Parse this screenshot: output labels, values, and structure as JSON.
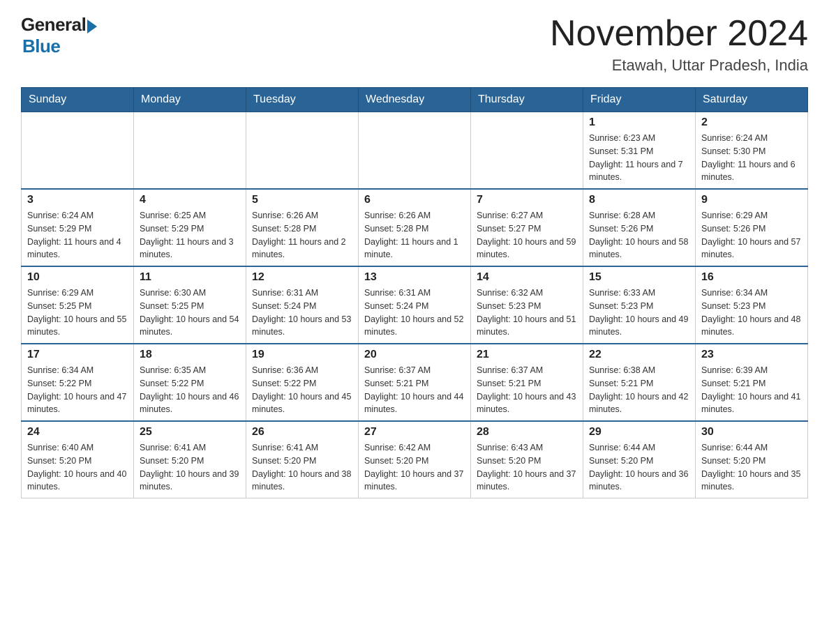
{
  "logo": {
    "general": "General",
    "blue": "Blue"
  },
  "title": "November 2024",
  "subtitle": "Etawah, Uttar Pradesh, India",
  "days_of_week": [
    "Sunday",
    "Monday",
    "Tuesday",
    "Wednesday",
    "Thursday",
    "Friday",
    "Saturday"
  ],
  "weeks": [
    [
      {
        "day": "",
        "info": ""
      },
      {
        "day": "",
        "info": ""
      },
      {
        "day": "",
        "info": ""
      },
      {
        "day": "",
        "info": ""
      },
      {
        "day": "",
        "info": ""
      },
      {
        "day": "1",
        "info": "Sunrise: 6:23 AM\nSunset: 5:31 PM\nDaylight: 11 hours and 7 minutes."
      },
      {
        "day": "2",
        "info": "Sunrise: 6:24 AM\nSunset: 5:30 PM\nDaylight: 11 hours and 6 minutes."
      }
    ],
    [
      {
        "day": "3",
        "info": "Sunrise: 6:24 AM\nSunset: 5:29 PM\nDaylight: 11 hours and 4 minutes."
      },
      {
        "day": "4",
        "info": "Sunrise: 6:25 AM\nSunset: 5:29 PM\nDaylight: 11 hours and 3 minutes."
      },
      {
        "day": "5",
        "info": "Sunrise: 6:26 AM\nSunset: 5:28 PM\nDaylight: 11 hours and 2 minutes."
      },
      {
        "day": "6",
        "info": "Sunrise: 6:26 AM\nSunset: 5:28 PM\nDaylight: 11 hours and 1 minute."
      },
      {
        "day": "7",
        "info": "Sunrise: 6:27 AM\nSunset: 5:27 PM\nDaylight: 10 hours and 59 minutes."
      },
      {
        "day": "8",
        "info": "Sunrise: 6:28 AM\nSunset: 5:26 PM\nDaylight: 10 hours and 58 minutes."
      },
      {
        "day": "9",
        "info": "Sunrise: 6:29 AM\nSunset: 5:26 PM\nDaylight: 10 hours and 57 minutes."
      }
    ],
    [
      {
        "day": "10",
        "info": "Sunrise: 6:29 AM\nSunset: 5:25 PM\nDaylight: 10 hours and 55 minutes."
      },
      {
        "day": "11",
        "info": "Sunrise: 6:30 AM\nSunset: 5:25 PM\nDaylight: 10 hours and 54 minutes."
      },
      {
        "day": "12",
        "info": "Sunrise: 6:31 AM\nSunset: 5:24 PM\nDaylight: 10 hours and 53 minutes."
      },
      {
        "day": "13",
        "info": "Sunrise: 6:31 AM\nSunset: 5:24 PM\nDaylight: 10 hours and 52 minutes."
      },
      {
        "day": "14",
        "info": "Sunrise: 6:32 AM\nSunset: 5:23 PM\nDaylight: 10 hours and 51 minutes."
      },
      {
        "day": "15",
        "info": "Sunrise: 6:33 AM\nSunset: 5:23 PM\nDaylight: 10 hours and 49 minutes."
      },
      {
        "day": "16",
        "info": "Sunrise: 6:34 AM\nSunset: 5:23 PM\nDaylight: 10 hours and 48 minutes."
      }
    ],
    [
      {
        "day": "17",
        "info": "Sunrise: 6:34 AM\nSunset: 5:22 PM\nDaylight: 10 hours and 47 minutes."
      },
      {
        "day": "18",
        "info": "Sunrise: 6:35 AM\nSunset: 5:22 PM\nDaylight: 10 hours and 46 minutes."
      },
      {
        "day": "19",
        "info": "Sunrise: 6:36 AM\nSunset: 5:22 PM\nDaylight: 10 hours and 45 minutes."
      },
      {
        "day": "20",
        "info": "Sunrise: 6:37 AM\nSunset: 5:21 PM\nDaylight: 10 hours and 44 minutes."
      },
      {
        "day": "21",
        "info": "Sunrise: 6:37 AM\nSunset: 5:21 PM\nDaylight: 10 hours and 43 minutes."
      },
      {
        "day": "22",
        "info": "Sunrise: 6:38 AM\nSunset: 5:21 PM\nDaylight: 10 hours and 42 minutes."
      },
      {
        "day": "23",
        "info": "Sunrise: 6:39 AM\nSunset: 5:21 PM\nDaylight: 10 hours and 41 minutes."
      }
    ],
    [
      {
        "day": "24",
        "info": "Sunrise: 6:40 AM\nSunset: 5:20 PM\nDaylight: 10 hours and 40 minutes."
      },
      {
        "day": "25",
        "info": "Sunrise: 6:41 AM\nSunset: 5:20 PM\nDaylight: 10 hours and 39 minutes."
      },
      {
        "day": "26",
        "info": "Sunrise: 6:41 AM\nSunset: 5:20 PM\nDaylight: 10 hours and 38 minutes."
      },
      {
        "day": "27",
        "info": "Sunrise: 6:42 AM\nSunset: 5:20 PM\nDaylight: 10 hours and 37 minutes."
      },
      {
        "day": "28",
        "info": "Sunrise: 6:43 AM\nSunset: 5:20 PM\nDaylight: 10 hours and 37 minutes."
      },
      {
        "day": "29",
        "info": "Sunrise: 6:44 AM\nSunset: 5:20 PM\nDaylight: 10 hours and 36 minutes."
      },
      {
        "day": "30",
        "info": "Sunrise: 6:44 AM\nSunset: 5:20 PM\nDaylight: 10 hours and 35 minutes."
      }
    ]
  ]
}
